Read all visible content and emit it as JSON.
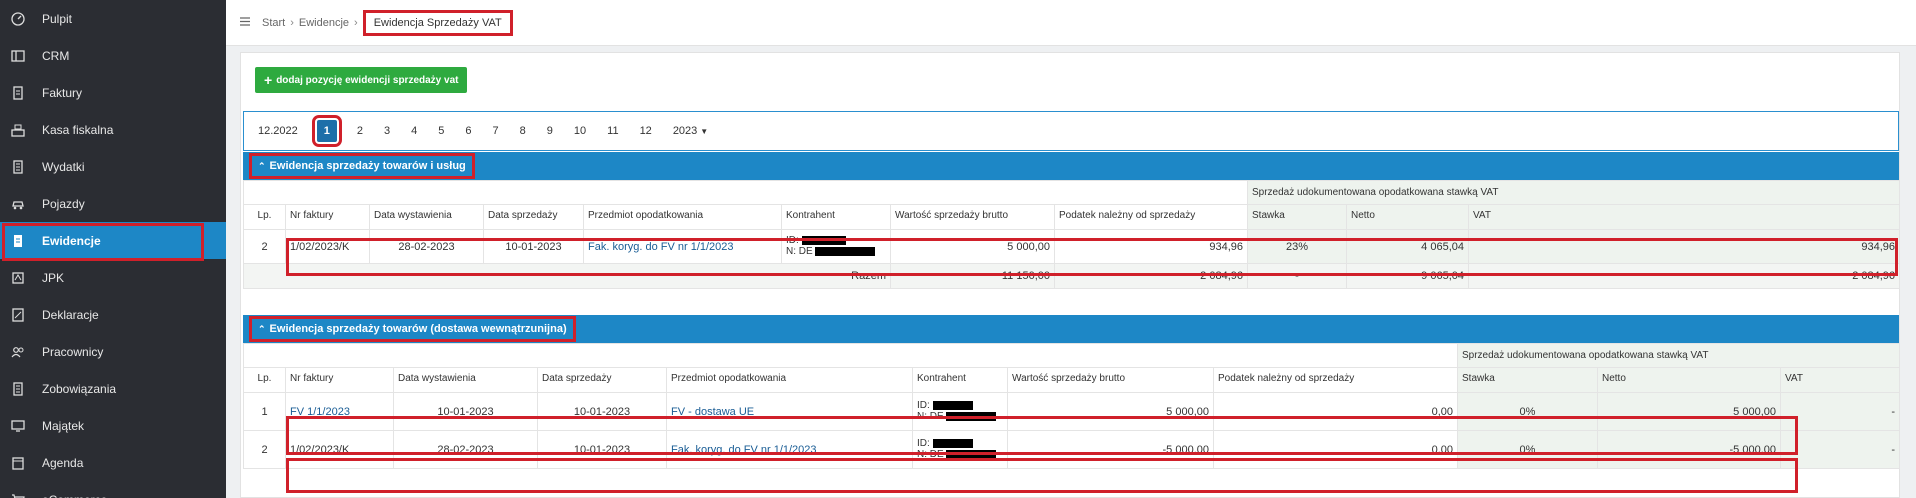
{
  "sidebar": {
    "items": [
      {
        "label": "Pulpit",
        "icon": "dashboard-icon"
      },
      {
        "label": "CRM",
        "icon": "crm-icon"
      },
      {
        "label": "Faktury",
        "icon": "invoice-icon"
      },
      {
        "label": "Kasa fiskalna",
        "icon": "cash-register-icon"
      },
      {
        "label": "Wydatki",
        "icon": "expenses-icon"
      },
      {
        "label": "Pojazdy",
        "icon": "car-icon"
      },
      {
        "label": "Ewidencje",
        "icon": "records-icon"
      },
      {
        "label": "JPK",
        "icon": "jpk-icon"
      },
      {
        "label": "Deklaracje",
        "icon": "declarations-icon"
      },
      {
        "label": "Pracownicy",
        "icon": "employees-icon"
      },
      {
        "label": "Zobowiązania",
        "icon": "liabilities-icon"
      },
      {
        "label": "Majątek",
        "icon": "assets-icon"
      },
      {
        "label": "Agenda",
        "icon": "calendar-icon"
      },
      {
        "label": "eCommerce",
        "icon": "ecommerce-icon"
      }
    ],
    "active": "Ewidencje"
  },
  "breadcrumb": {
    "start": "Start",
    "ewidencje": "Ewidencje",
    "current": "Ewidencja Sprzedaży VAT"
  },
  "add_button": "dodaj pozycję ewidencji sprzedaży vat",
  "months": {
    "prev": "12.2022",
    "items": [
      "1",
      "2",
      "3",
      "4",
      "5",
      "6",
      "7",
      "8",
      "9",
      "10",
      "11",
      "12"
    ],
    "next": "2023",
    "active": "1"
  },
  "section1": {
    "title": "Ewidencja sprzedaży towarów i usług",
    "group_header": "Sprzedaż udokumentowana opodatkowana stawką VAT",
    "columns": [
      "Lp.",
      "Nr faktury",
      "Data wystawienia",
      "Data sprzedaży",
      "Przedmiot opodatkowania",
      "Kontrahent",
      "Wartość sprzedaży brutto",
      "Podatek należny od sprzedaży",
      "Stawka",
      "Netto",
      "VAT"
    ],
    "rows": [
      {
        "lp": "2",
        "nr": "1/02/2023/K",
        "data_wyst": "28-02-2023",
        "data_sprz": "10-01-2023",
        "przedmiot": "Fak. koryg. do FV nr 1/1/2023",
        "kontrahent_id": "ID:",
        "kontrahent_n": "N: DE",
        "brutto": "5 000,00",
        "podatek": "934,96",
        "stawka": "23%",
        "netto": "4 065,04",
        "vat": "934,96"
      }
    ],
    "sum": {
      "label": "Razem",
      "brutto": "11 150,00",
      "podatek": "2 084,96",
      "stawka": "-",
      "netto": "9 065,04",
      "vat": "2 084,96"
    }
  },
  "section2": {
    "title": "Ewidencja sprzedaży towarów (dostawa wewnątrzunijna)",
    "group_header": "Sprzedaż udokumentowana opodatkowana stawką VAT",
    "columns": [
      "Lp.",
      "Nr faktury",
      "Data wystawienia",
      "Data sprzedaży",
      "Przedmiot opodatkowania",
      "Kontrahent",
      "Wartość sprzedaży brutto",
      "Podatek należny od sprzedaży",
      "Stawka",
      "Netto",
      "VAT"
    ],
    "rows": [
      {
        "lp": "1",
        "nr": "FV 1/1/2023",
        "data_wyst": "10-01-2023",
        "data_sprz": "10-01-2023",
        "przedmiot": "FV - dostawa UE",
        "kontrahent_id": "ID:",
        "kontrahent_n": "N: DE",
        "brutto": "5 000,00",
        "podatek": "0,00",
        "stawka": "0%",
        "netto": "5 000,00",
        "vat": "-"
      },
      {
        "lp": "2",
        "nr": "1/02/2023/K",
        "data_wyst": "28-02-2023",
        "data_sprz": "10-01-2023",
        "przedmiot": "Fak. koryg. do FV nr 1/1/2023",
        "kontrahent_id": "ID:",
        "kontrahent_n": "N: DE",
        "brutto": "-5 000,00",
        "podatek": "0,00",
        "stawka": "0%",
        "netto": "-5 000,00",
        "vat": "-"
      }
    ]
  }
}
